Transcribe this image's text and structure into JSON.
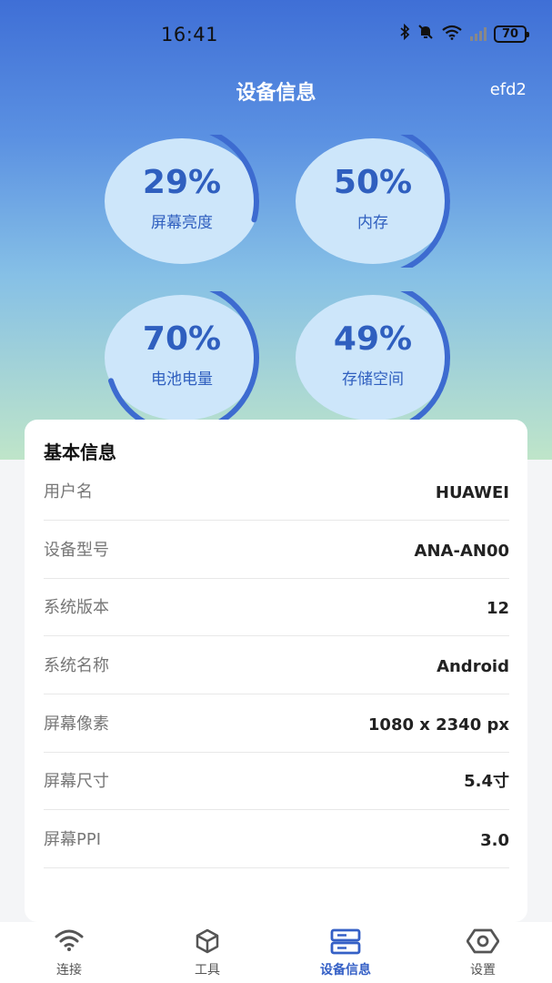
{
  "status_bar": {
    "time": "16:41",
    "battery": "70"
  },
  "header": {
    "title": "设备信息",
    "right_text": "efd2"
  },
  "gauges": [
    {
      "value": "29%",
      "label": "屏幕亮度",
      "percent": 29
    },
    {
      "value": "50%",
      "label": "内存",
      "percent": 50
    },
    {
      "value": "70%",
      "label": "电池电量",
      "percent": 70
    },
    {
      "value": "49%",
      "label": "存储空间",
      "percent": 49
    }
  ],
  "basic_info": {
    "title": "基本信息",
    "rows": [
      {
        "label": "用户名",
        "value": "HUAWEI"
      },
      {
        "label": "设备型号",
        "value": "ANA-AN00"
      },
      {
        "label": "系统版本",
        "value": "12"
      },
      {
        "label": "系统名称",
        "value": "Android"
      },
      {
        "label": "屏幕像素",
        "value": "1080 x 2340 px"
      },
      {
        "label": "屏幕尺寸",
        "value": "5.4寸"
      },
      {
        "label": "屏幕PPI",
        "value": "3.0"
      }
    ]
  },
  "tabbar": {
    "tabs": [
      {
        "label": "连接",
        "icon": "wifi-icon"
      },
      {
        "label": "工具",
        "icon": "cube-icon"
      },
      {
        "label": "设备信息",
        "icon": "device-info-icon",
        "active": true
      },
      {
        "label": "设置",
        "icon": "settings-icon"
      }
    ]
  },
  "colors": {
    "accent": "#3560c6",
    "gauge_fill": "#cde6fa",
    "arc": "#3d6bd0"
  }
}
